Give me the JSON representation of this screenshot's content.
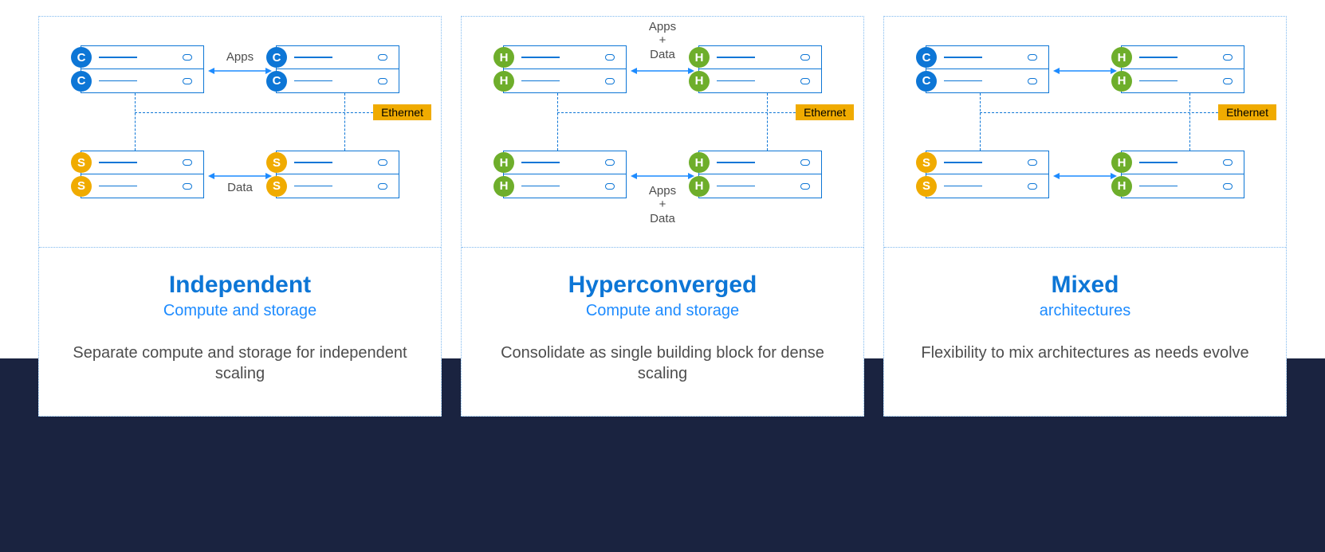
{
  "panels": [
    {
      "title": "Independent",
      "subtitle": "Compute and storage",
      "description": "Separate compute and storage for independent scaling",
      "label_top": "Apps",
      "label_bottom": "Data",
      "ethernet": "Ethernet",
      "badges": {
        "tl": "C",
        "tr": "C",
        "bl": "S",
        "br": "S"
      },
      "badge_kinds": {
        "tl": "c",
        "tr": "c",
        "bl": "s",
        "br": "s"
      }
    },
    {
      "title": "Hyperconverged",
      "subtitle": "Compute and storage",
      "description": "Consolidate as single building block for dense scaling",
      "label_top": "Apps\n+\nData",
      "label_bottom": "Apps\n+\nData",
      "ethernet": "Ethernet",
      "badges": {
        "tl": "H",
        "tr": "H",
        "bl": "H",
        "br": "H"
      },
      "badge_kinds": {
        "tl": "h",
        "tr": "h",
        "bl": "h",
        "br": "h"
      }
    },
    {
      "title": "Mixed",
      "subtitle": "architectures",
      "description": "Flexibility to mix architectures as needs evolve",
      "label_top": "",
      "label_bottom": "",
      "ethernet": "Ethernet",
      "badges": {
        "tl": "C",
        "tr": "H",
        "bl": "S",
        "br": "H"
      },
      "badge_kinds": {
        "tl": "c",
        "tr": "h",
        "bl": "s",
        "br": "h"
      }
    }
  ]
}
